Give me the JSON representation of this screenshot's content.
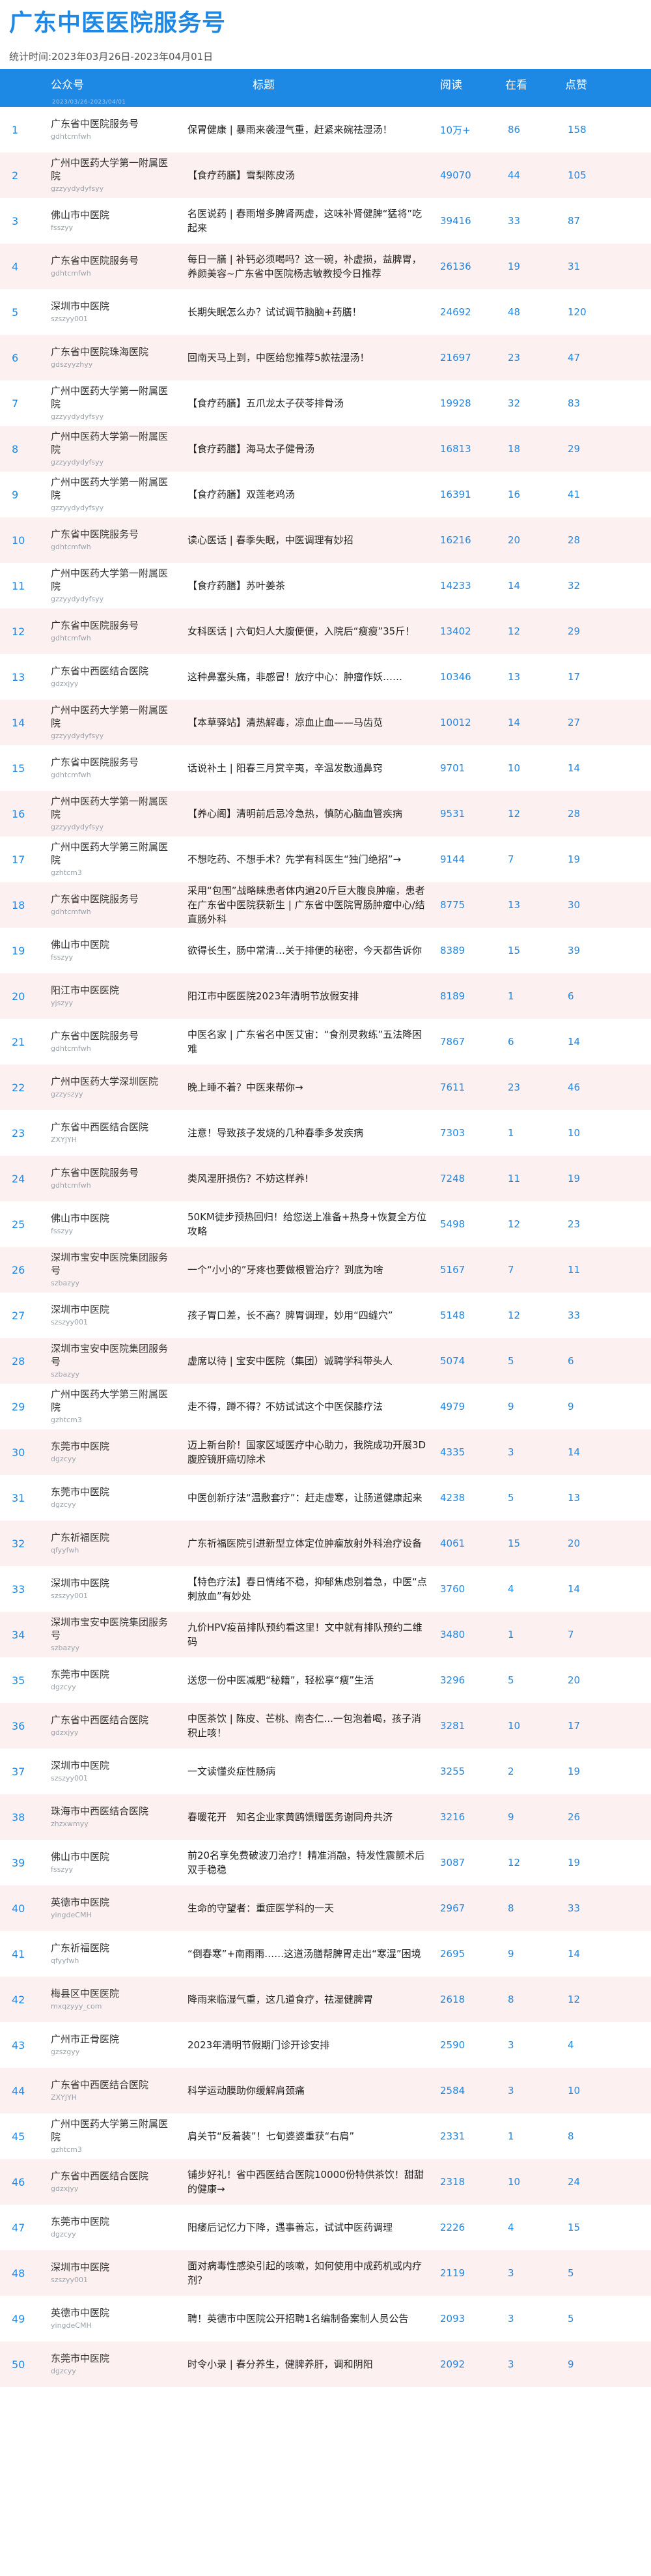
{
  "page": {
    "title": "广东中医医院服务号",
    "subtitle": "统计时间:2023年03月26日-2023年04月01日",
    "date_strip": "2023/03/26-2023/04/01"
  },
  "columns": {
    "account": "公众号",
    "title": "标题",
    "read": "阅读",
    "look": "在看",
    "like": "点赞"
  },
  "rows": [
    {
      "rank": "1",
      "name": "广东省中医院服务号",
      "id": "gdhtcmfwh",
      "title": "保胃健康 | 暴雨来袭湿气重，赶紧来碗祛湿汤！",
      "read": "10万+",
      "look": "86",
      "like": "158"
    },
    {
      "rank": "2",
      "name": "广州中医药大学第一附属医院",
      "id": "gzzyydydyfsyy",
      "title": "【食疗药膳】雪梨陈皮汤",
      "read": "49070",
      "look": "44",
      "like": "105"
    },
    {
      "rank": "3",
      "name": "佛山市中医院",
      "id": "fsszyy",
      "title": "名医说药 | 春雨增多脾肾两虚，这味补肾健脾“猛将”吃起来",
      "read": "39416",
      "look": "33",
      "like": "87"
    },
    {
      "rank": "4",
      "name": "广东省中医院服务号",
      "id": "gdhtcmfwh",
      "title": "每日一膳 | 补钙必须喝吗？这一碗，补虚损，益脾胃，养颜美容~广东省中医院杨志敏教授今日推荐",
      "read": "26136",
      "look": "19",
      "like": "31"
    },
    {
      "rank": "5",
      "name": "深圳市中医院",
      "id": "szszyy001",
      "title": "长期失眠怎么办？试试调节脑脑+药膳！",
      "read": "24692",
      "look": "48",
      "like": "120"
    },
    {
      "rank": "6",
      "name": "广东省中医院珠海医院",
      "id": "gdszyyzhyy",
      "title": "回南天马上到，中医给您推荐5款祛湿汤！",
      "read": "21697",
      "look": "23",
      "like": "47"
    },
    {
      "rank": "7",
      "name": "广州中医药大学第一附属医院",
      "id": "gzzyydydyfsyy",
      "title": "【食疗药膳】五爪龙太子茯苓排骨汤",
      "read": "19928",
      "look": "32",
      "like": "83"
    },
    {
      "rank": "8",
      "name": "广州中医药大学第一附属医院",
      "id": "gzzyydydyfsyy",
      "title": "【食疗药膳】海马太子健骨汤",
      "read": "16813",
      "look": "18",
      "like": "29"
    },
    {
      "rank": "9",
      "name": "广州中医药大学第一附属医院",
      "id": "gzzyydydyfsyy",
      "title": "【食疗药膳】双莲老鸡汤",
      "read": "16391",
      "look": "16",
      "like": "41"
    },
    {
      "rank": "10",
      "name": "广东省中医院服务号",
      "id": "gdhtcmfwh",
      "title": "读心医话 | 春季失眠，中医调理有妙招",
      "read": "16216",
      "look": "20",
      "like": "28"
    },
    {
      "rank": "11",
      "name": "广州中医药大学第一附属医院",
      "id": "gzzyydydyfsyy",
      "title": "【食疗药膳】苏叶姜茶",
      "read": "14233",
      "look": "14",
      "like": "32"
    },
    {
      "rank": "12",
      "name": "广东省中医院服务号",
      "id": "gdhtcmfwh",
      "title": "女科医话 | 六旬妇人大腹便便，入院后“瘦瘦”35斤！",
      "read": "13402",
      "look": "12",
      "like": "29"
    },
    {
      "rank": "13",
      "name": "广东省中西医结合医院",
      "id": "gdzxjyy",
      "title": "这种鼻塞头痛，非感冒！放疗中心：肿瘤作妖……",
      "read": "10346",
      "look": "13",
      "like": "17"
    },
    {
      "rank": "14",
      "name": "广州中医药大学第一附属医院",
      "id": "gzzyydydyfsyy",
      "title": "【本草驿站】清热解毒，凉血止血——马齿苋",
      "read": "10012",
      "look": "14",
      "like": "27"
    },
    {
      "rank": "15",
      "name": "广东省中医院服务号",
      "id": "gdhtcmfwh",
      "title": "话说补土 | 阳春三月赏辛夷，辛温发散通鼻窍",
      "read": "9701",
      "look": "10",
      "like": "14"
    },
    {
      "rank": "16",
      "name": "广州中医药大学第一附属医院",
      "id": "gzzyydydyfsyy",
      "title": "【养心阁】清明前后忌冷急热，慎防心脑血管疾病",
      "read": "9531",
      "look": "12",
      "like": "28"
    },
    {
      "rank": "17",
      "name": "广州中医药大学第三附属医院",
      "id": "gzhtcm3",
      "title": "不想吃药、不想手术？先学有科医生“独门绝招”→",
      "read": "9144",
      "look": "7",
      "like": "19"
    },
    {
      "rank": "18",
      "name": "广东省中医院服务号",
      "id": "gdhtcmfwh",
      "title": "采用“包围”战略睐患者体内遍20斤巨大腹良肿瘤，患者在广东省中医院获新生 | 广东省中医院胃肠肿瘤中心/结直肠外科",
      "read": "8775",
      "look": "13",
      "like": "30"
    },
    {
      "rank": "19",
      "name": "佛山市中医院",
      "id": "fsszyy",
      "title": "欲得长生，肠中常清…关于排便的秘密，今天都告诉你",
      "read": "8389",
      "look": "15",
      "like": "39"
    },
    {
      "rank": "20",
      "name": "阳江市中医医院",
      "id": "yjszyy",
      "title": "阳江市中医医院2023年清明节放假安排",
      "read": "8189",
      "look": "1",
      "like": "6"
    },
    {
      "rank": "21",
      "name": "广东省中医院服务号",
      "id": "gdhtcmfwh",
      "title": "中医名家 | 广东省名中医艾宙：“食剂灵救练”五法降困难",
      "read": "7867",
      "look": "6",
      "like": "14"
    },
    {
      "rank": "22",
      "name": "广州中医药大学深圳医院",
      "id": "gzzyszyy",
      "title": "晚上睡不着？中医来帮你→",
      "read": "7611",
      "look": "23",
      "like": "46"
    },
    {
      "rank": "23",
      "name": "广东省中西医结合医院",
      "id": "ZXYJYH",
      "title": "注意！导致孩子发烧的几种春季多发疾病",
      "read": "7303",
      "look": "1",
      "like": "10"
    },
    {
      "rank": "24",
      "name": "广东省中医院服务号",
      "id": "gdhtcmfwh",
      "title": "类风湿肝损伤？不妨这样养!",
      "read": "7248",
      "look": "11",
      "like": "19"
    },
    {
      "rank": "25",
      "name": "佛山市中医院",
      "id": "fsszyy",
      "title": "50KM徒步预热回归！给您送上准备+热身+恢复全方位攻略",
      "read": "5498",
      "look": "12",
      "like": "23"
    },
    {
      "rank": "26",
      "name": "深圳市宝安中医院集团服务号",
      "id": "szbazyy",
      "title": "一个“小小的”牙疼也要做根管治疗？到底为啥",
      "read": "5167",
      "look": "7",
      "like": "11"
    },
    {
      "rank": "27",
      "name": "深圳市中医院",
      "id": "szszyy001",
      "title": "孩子胃口差，长不高？脾胃调理，妙用“四缝穴”",
      "read": "5148",
      "look": "12",
      "like": "33"
    },
    {
      "rank": "28",
      "name": "深圳市宝安中医院集团服务号",
      "id": "szbazyy",
      "title": "虚席以待 | 宝安中医院（集团）诚聘学科带头人",
      "read": "5074",
      "look": "5",
      "like": "6"
    },
    {
      "rank": "29",
      "name": "广州中医药大学第三附属医院",
      "id": "gzhtcm3",
      "title": "走不得，蹲不得？不妨试试这个中医保膝疗法",
      "read": "4979",
      "look": "9",
      "like": "9"
    },
    {
      "rank": "30",
      "name": "东莞市中医院",
      "id": "dgzcyy",
      "title": "迈上新台阶！国家区域医疗中心助力，我院成功开展3D腹腔镜肝癌切除术",
      "read": "4335",
      "look": "3",
      "like": "14"
    },
    {
      "rank": "31",
      "name": "东莞市中医院",
      "id": "dgzcyy",
      "title": "中医创新疗法“温敷套疗”：赶走虚寒，让肠道健康起来",
      "read": "4238",
      "look": "5",
      "like": "13"
    },
    {
      "rank": "32",
      "name": "广东祈福医院",
      "id": "qfyyfwh",
      "title": "广东祈福医院引进新型立体定位肿瘤放射外科治疗设备",
      "read": "4061",
      "look": "15",
      "like": "20"
    },
    {
      "rank": "33",
      "name": "深圳市中医院",
      "id": "szszyy001",
      "title": "【特色疗法】春日情绪不稳，抑郁焦虑别着急，中医“点刺放血”有妙处",
      "read": "3760",
      "look": "4",
      "like": "14"
    },
    {
      "rank": "34",
      "name": "深圳市宝安中医院集团服务号",
      "id": "szbazyy",
      "title": "九价HPV疫苗排队预约看这里！文中就有排队预约二维码",
      "read": "3480",
      "look": "1",
      "like": "7"
    },
    {
      "rank": "35",
      "name": "东莞市中医院",
      "id": "dgzcyy",
      "title": "送您一份中医减肥“秘籍”，轻松享“瘦”生活",
      "read": "3296",
      "look": "5",
      "like": "20"
    },
    {
      "rank": "36",
      "name": "广东省中西医结合医院",
      "id": "gdzxjyy",
      "title": "中医茶饮 | 陈皮、芒桃、南杏仁...一包泡着喝，孩子消积止咳！",
      "read": "3281",
      "look": "10",
      "like": "17"
    },
    {
      "rank": "37",
      "name": "深圳市中医院",
      "id": "szszyy001",
      "title": "一文读懂炎症性肠病",
      "read": "3255",
      "look": "2",
      "like": "19"
    },
    {
      "rank": "38",
      "name": "珠海市中西医结合医院",
      "id": "zhzxwmyy",
      "title": "春暖花开　知名企业家黄鸥馈赠医务谢同舟共济",
      "read": "3216",
      "look": "9",
      "like": "26"
    },
    {
      "rank": "39",
      "name": "佛山市中医院",
      "id": "fsszyy",
      "title": "前20名享免费破波刀治疗！精准消融，特发性震颤术后双手稳稳",
      "read": "3087",
      "look": "12",
      "like": "19"
    },
    {
      "rank": "40",
      "name": "英德市中医院",
      "id": "yingdeCMH",
      "title": "生命的守望者：重症医学科的一天",
      "read": "2967",
      "look": "8",
      "like": "33"
    },
    {
      "rank": "41",
      "name": "广东祈福医院",
      "id": "qfyyfwh",
      "title": "“倒春寒”+南雨雨……这道汤膳帮脾胃走出“寒湿”困境",
      "read": "2695",
      "look": "9",
      "like": "14"
    },
    {
      "rank": "42",
      "name": "梅县区中医医院",
      "id": "mxqzyyy_com",
      "title": "降雨来临湿气重，这几道食疗，祛湿健脾胃",
      "read": "2618",
      "look": "8",
      "like": "12"
    },
    {
      "rank": "43",
      "name": "广州市正骨医院",
      "id": "gzszgyy",
      "title": "2023年清明节假期门诊开诊安排",
      "read": "2590",
      "look": "3",
      "like": "4"
    },
    {
      "rank": "44",
      "name": "广东省中西医结合医院",
      "id": "ZXYJYH",
      "title": "科学运动膜助你缓解肩颈痛",
      "read": "2584",
      "look": "3",
      "like": "10"
    },
    {
      "rank": "45",
      "name": "广州中医药大学第三附属医院",
      "id": "gzhtcm3",
      "title": "肩关节“反着装”！七旬婆婆重获“右肩”",
      "read": "2331",
      "look": "1",
      "like": "8"
    },
    {
      "rank": "46",
      "name": "广东省中西医结合医院",
      "id": "gdzxjyy",
      "title": "铺步好礼！省中西医结合医院10000份特供茶饮！甜甜的健康→",
      "read": "2318",
      "look": "10",
      "like": "24"
    },
    {
      "rank": "47",
      "name": "东莞市中医院",
      "id": "dgzcyy",
      "title": "阳痿后记忆力下降，遇事善忘，试试中医药调理",
      "read": "2226",
      "look": "4",
      "like": "15"
    },
    {
      "rank": "48",
      "name": "深圳市中医院",
      "id": "szszyy001",
      "title": "面对病毒性感染引起的咳嗽，如何使用中成药机或内疗剂？",
      "read": "2119",
      "look": "3",
      "like": "5"
    },
    {
      "rank": "49",
      "name": "英德市中医院",
      "id": "yingdeCMH",
      "title": "聘！英德市中医院公开招聘1名编制备案制人员公告",
      "read": "2093",
      "look": "3",
      "like": "5"
    },
    {
      "rank": "50",
      "name": "东莞市中医院",
      "id": "dgzcyy",
      "title": "时令小录 | 春分养生，健脾养肝，调和阴阳",
      "read": "2092",
      "look": "3",
      "like": "9"
    }
  ]
}
